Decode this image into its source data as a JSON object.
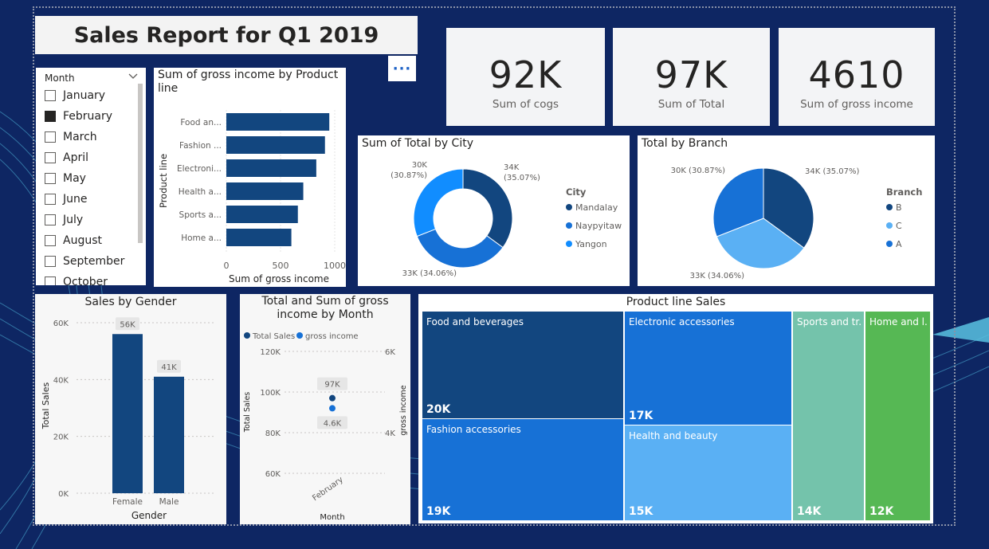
{
  "report_title": "Sales Report for Q1 2019",
  "more_options": "···",
  "kpis": [
    {
      "value": "92K",
      "label": "Sum of cogs"
    },
    {
      "value": "97K",
      "label": "Sum of Total"
    },
    {
      "value": "4610",
      "label": "Sum of gross income"
    }
  ],
  "slicer": {
    "title": "Month",
    "items": [
      {
        "label": "January",
        "checked": false
      },
      {
        "label": "February",
        "checked": true
      },
      {
        "label": "March",
        "checked": false
      },
      {
        "label": "April",
        "checked": false
      },
      {
        "label": "May",
        "checked": false
      },
      {
        "label": "June",
        "checked": false
      },
      {
        "label": "July",
        "checked": false
      },
      {
        "label": "August",
        "checked": false
      },
      {
        "label": "September",
        "checked": false
      },
      {
        "label": "October",
        "checked": false
      }
    ]
  },
  "colors": {
    "dark_blue": "#12467f",
    "blue": "#1771d6",
    "light_blue": "#5ab0f4",
    "teal": "#74c3ab",
    "green": "#56b854",
    "background": "#0e2663"
  },
  "chart_data": [
    {
      "type": "bar",
      "orientation": "horizontal",
      "title": "Sum of gross income by Product line",
      "xlabel": "Sum of gross income",
      "ylabel": "Product line",
      "categories": [
        "Food an...",
        "Fashion ...",
        "Electroni...",
        "Health a...",
        "Sports a...",
        "Home a..."
      ],
      "values": [
        950,
        910,
        830,
        710,
        660,
        600
      ],
      "xlim": [
        0,
        1000
      ],
      "xticks": [
        "0",
        "500",
        "1000"
      ]
    },
    {
      "type": "pie",
      "variant": "donut",
      "title": "Sum of Total by City",
      "legend_title": "City",
      "legend_position": "right",
      "slices": [
        {
          "name": "Mandalay",
          "value": 34,
          "label": "34K\n(35.07%)"
        },
        {
          "name": "Naypyitaw",
          "value": 33,
          "label": "33K (34.06%)"
        },
        {
          "name": "Yangon",
          "value": 30,
          "label": "30K\n(30.87%)"
        }
      ]
    },
    {
      "type": "pie",
      "title": "Total by Branch",
      "legend_title": "Branch",
      "legend_position": "right",
      "slices": [
        {
          "name": "B",
          "value": 34,
          "label": "34K (35.07%)"
        },
        {
          "name": "C",
          "value": 33,
          "label": "33K (34.06%)"
        },
        {
          "name": "A",
          "value": 30,
          "label": "30K (30.87%)"
        }
      ]
    },
    {
      "type": "bar",
      "title": "Sales by Gender",
      "xlabel": "Gender",
      "ylabel": "Total Sales",
      "categories": [
        "Female",
        "Male"
      ],
      "values": [
        56,
        41
      ],
      "data_labels": [
        "56K",
        "41K"
      ],
      "ylim": [
        0,
        60
      ],
      "yticks": [
        "0K",
        "20K",
        "40K",
        "60K"
      ],
      "yticks_values": [
        0,
        20,
        40,
        60
      ]
    },
    {
      "type": "scatter",
      "title": "Total and Sum of gross income by Month",
      "xlabel": "Month",
      "ylabel": "Total Sales",
      "ylabel_right": "gross income",
      "categories": [
        "February"
      ],
      "series": [
        {
          "name": "Total Sales",
          "values": [
            97
          ],
          "data_label": "97K"
        },
        {
          "name": "gross income",
          "values": [
            4.6
          ],
          "data_label": "4.6K"
        }
      ],
      "left_ticks": [
        "60K",
        "80K",
        "100K",
        "120K"
      ],
      "right_ticks": [
        "4K",
        "6K"
      ]
    },
    {
      "type": "treemap",
      "title": "Product line Sales",
      "items": [
        {
          "name": "Food and beverages",
          "value": "20K"
        },
        {
          "name": "Fashion accessories",
          "value": "19K"
        },
        {
          "name": "Electronic accessories",
          "value": "17K"
        },
        {
          "name": "Health and beauty",
          "value": "15K"
        },
        {
          "name": "Sports and tr...",
          "value": "14K"
        },
        {
          "name": "Home and l...",
          "value": "12K"
        }
      ]
    }
  ]
}
